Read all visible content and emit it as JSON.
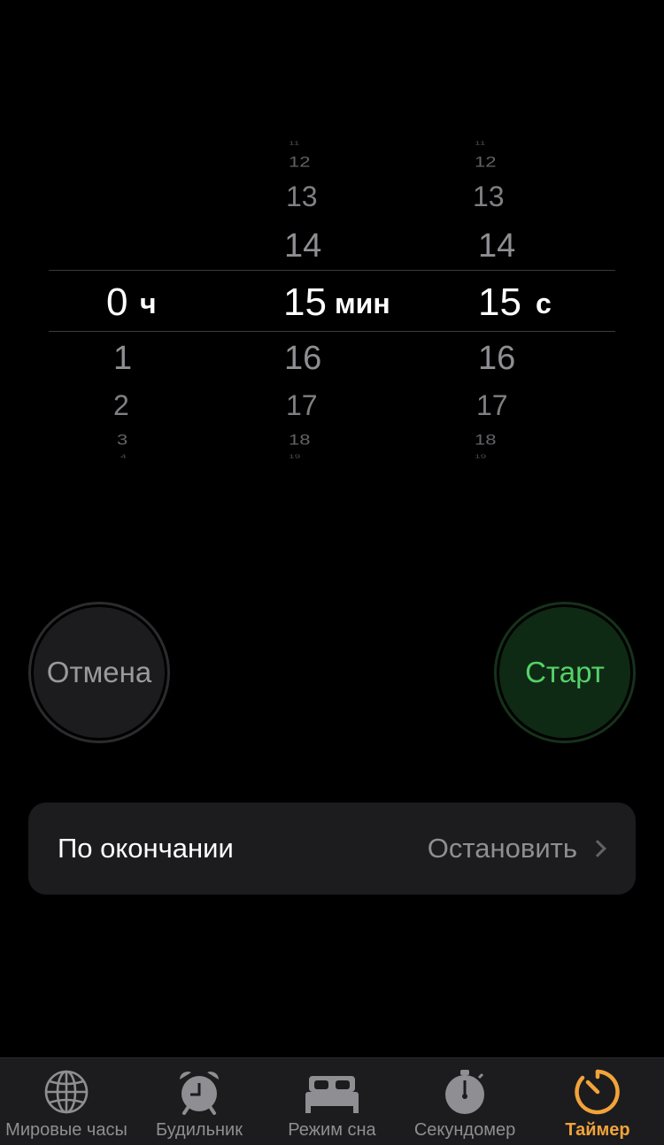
{
  "picker": {
    "hours": {
      "above": [],
      "selected": "0",
      "below": [
        "1",
        "2",
        "3",
        "4"
      ],
      "unit": "ч"
    },
    "minutes": {
      "above": [
        "11",
        "12",
        "13",
        "14"
      ],
      "selected": "15",
      "below": [
        "16",
        "17",
        "18",
        "19"
      ],
      "unit": "мин"
    },
    "seconds": {
      "above": [
        "11",
        "12",
        "13",
        "14"
      ],
      "selected": "15",
      "below": [
        "16",
        "17",
        "18",
        "19"
      ],
      "unit": "с"
    }
  },
  "buttons": {
    "cancel": "Отмена",
    "start": "Старт"
  },
  "when_ends": {
    "label": "По окончании",
    "value": "Остановить"
  },
  "tabs": [
    {
      "label": "Мировые часы",
      "icon": "globe-icon",
      "active": false
    },
    {
      "label": "Будильник",
      "icon": "alarm-clock-icon",
      "active": false
    },
    {
      "label": "Режим сна",
      "icon": "bed-icon",
      "active": false
    },
    {
      "label": "Секундомер",
      "icon": "stopwatch-icon",
      "active": false
    },
    {
      "label": "Таймер",
      "icon": "timer-icon",
      "active": true
    }
  ],
  "colors": {
    "accent": "#f2a33a",
    "start_green": "#55d16a",
    "inactive": "#8e8e93"
  }
}
